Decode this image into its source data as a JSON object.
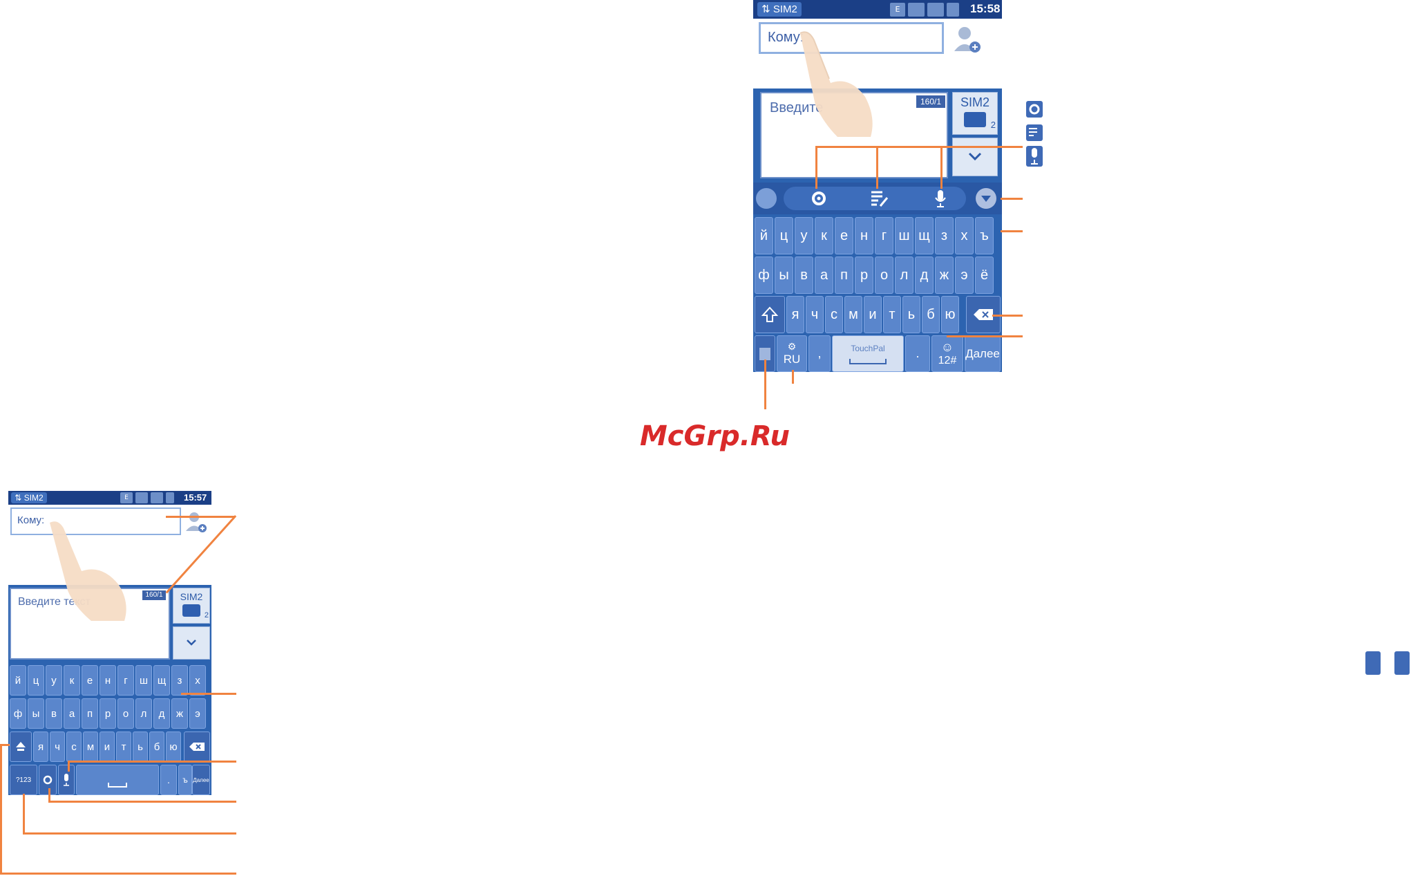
{
  "watermark": "McGrp.Ru",
  "phone_large": {
    "status": {
      "sim": "SIM2",
      "net": "E",
      "time": "15:58"
    },
    "to_label": "Кому:",
    "composer_placeholder": "Введите",
    "counter": "160/1",
    "sim_button": "SIM2",
    "sim_button_sub": "2",
    "rows": [
      [
        "й",
        "ц",
        "у",
        "к",
        "е",
        "н",
        "г",
        "ш",
        "щ",
        "з",
        "х",
        "ъ"
      ],
      [
        "ф",
        "ы",
        "в",
        "а",
        "п",
        "р",
        "о",
        "л",
        "д",
        "ж",
        "э",
        "ё"
      ],
      [
        "я",
        "ч",
        "с",
        "м",
        "и",
        "т",
        "ь",
        "б",
        "ю"
      ]
    ],
    "lang": "RU",
    "comma": ",",
    "space_label": "TouchPal",
    "period": ".",
    "sym": "12#",
    "next": "Далее"
  },
  "phone_small": {
    "status": {
      "sim": "SIM2",
      "net": "E",
      "time": "15:57"
    },
    "to_label": "Кому:",
    "composer_placeholder": "Введите текст",
    "counter": "160/1",
    "sim_button": "SIM2",
    "sim_button_sub": "2",
    "rows": [
      [
        "й",
        "ц",
        "у",
        "к",
        "е",
        "н",
        "г",
        "ш",
        "щ",
        "з",
        "х"
      ],
      [
        "ф",
        "ы",
        "в",
        "а",
        "п",
        "р",
        "о",
        "л",
        "д",
        "ж",
        "э"
      ],
      [
        "я",
        "ч",
        "с",
        "м",
        "и",
        "т",
        "ь",
        "б",
        "ю"
      ]
    ],
    "sym": "?123",
    "period": ".",
    "hard": "ъ",
    "next": "Далее"
  },
  "colors": {
    "phone_blue": "#2c63b0",
    "callout_orange": "#f08340",
    "logo_red": "#d92a2a"
  }
}
